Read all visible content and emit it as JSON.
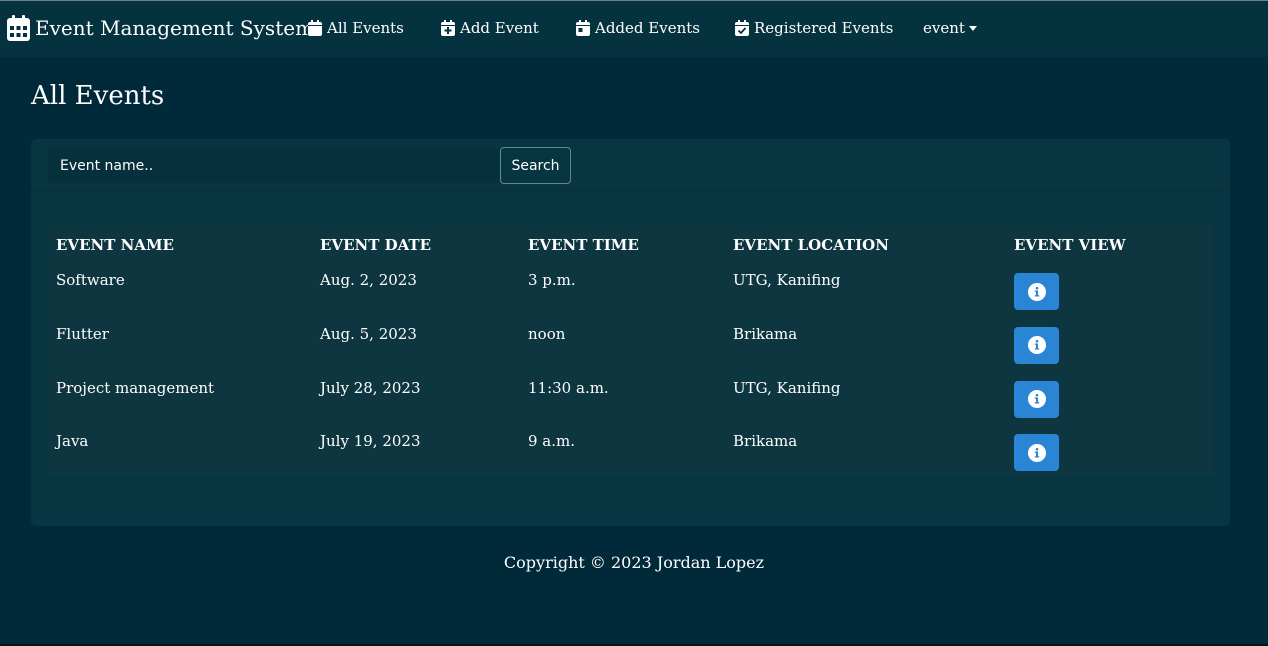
{
  "navbar": {
    "brand": "Event Management System",
    "brand_icon": "calendar-icon",
    "items": [
      {
        "label": "All Events",
        "icon": "calendar-icon"
      },
      {
        "label": "Add Event",
        "icon": "calendar-plus-icon"
      },
      {
        "label": "Added Events",
        "icon": "calendar-day-icon"
      },
      {
        "label": "Registered Events",
        "icon": "calendar-check-icon"
      }
    ],
    "user_menu": "event"
  },
  "page": {
    "title": "All Events"
  },
  "search": {
    "placeholder": "Event name..",
    "value": "",
    "button_label": "Search"
  },
  "table": {
    "headers": [
      "EVENT NAME",
      "EVENT DATE",
      "EVENT TIME",
      "EVENT LOCATION",
      "EVENT VIEW"
    ],
    "rows": [
      {
        "name": "Software",
        "date": "Aug. 2, 2023",
        "time": "3 p.m.",
        "location": "UTG, Kanifing",
        "view_icon": "info-icon"
      },
      {
        "name": "Flutter",
        "date": "Aug. 5, 2023",
        "time": "noon",
        "location": "Brikama",
        "view_icon": "info-icon"
      },
      {
        "name": "Project management",
        "date": "July 28, 2023",
        "time": "11:30 a.m.",
        "location": "UTG, Kanifing",
        "view_icon": "info-icon"
      },
      {
        "name": "Java",
        "date": "July 19, 2023",
        "time": "9 a.m.",
        "location": "Brikama",
        "view_icon": "info-icon"
      }
    ]
  },
  "footer": {
    "copyright": "Copyright © 2023 Jordan Lopez"
  },
  "colors": {
    "background": "#002a39",
    "navbar": "#04323f",
    "card": "#073542",
    "table": "#0e3640",
    "info_button": "#2a85d4"
  }
}
